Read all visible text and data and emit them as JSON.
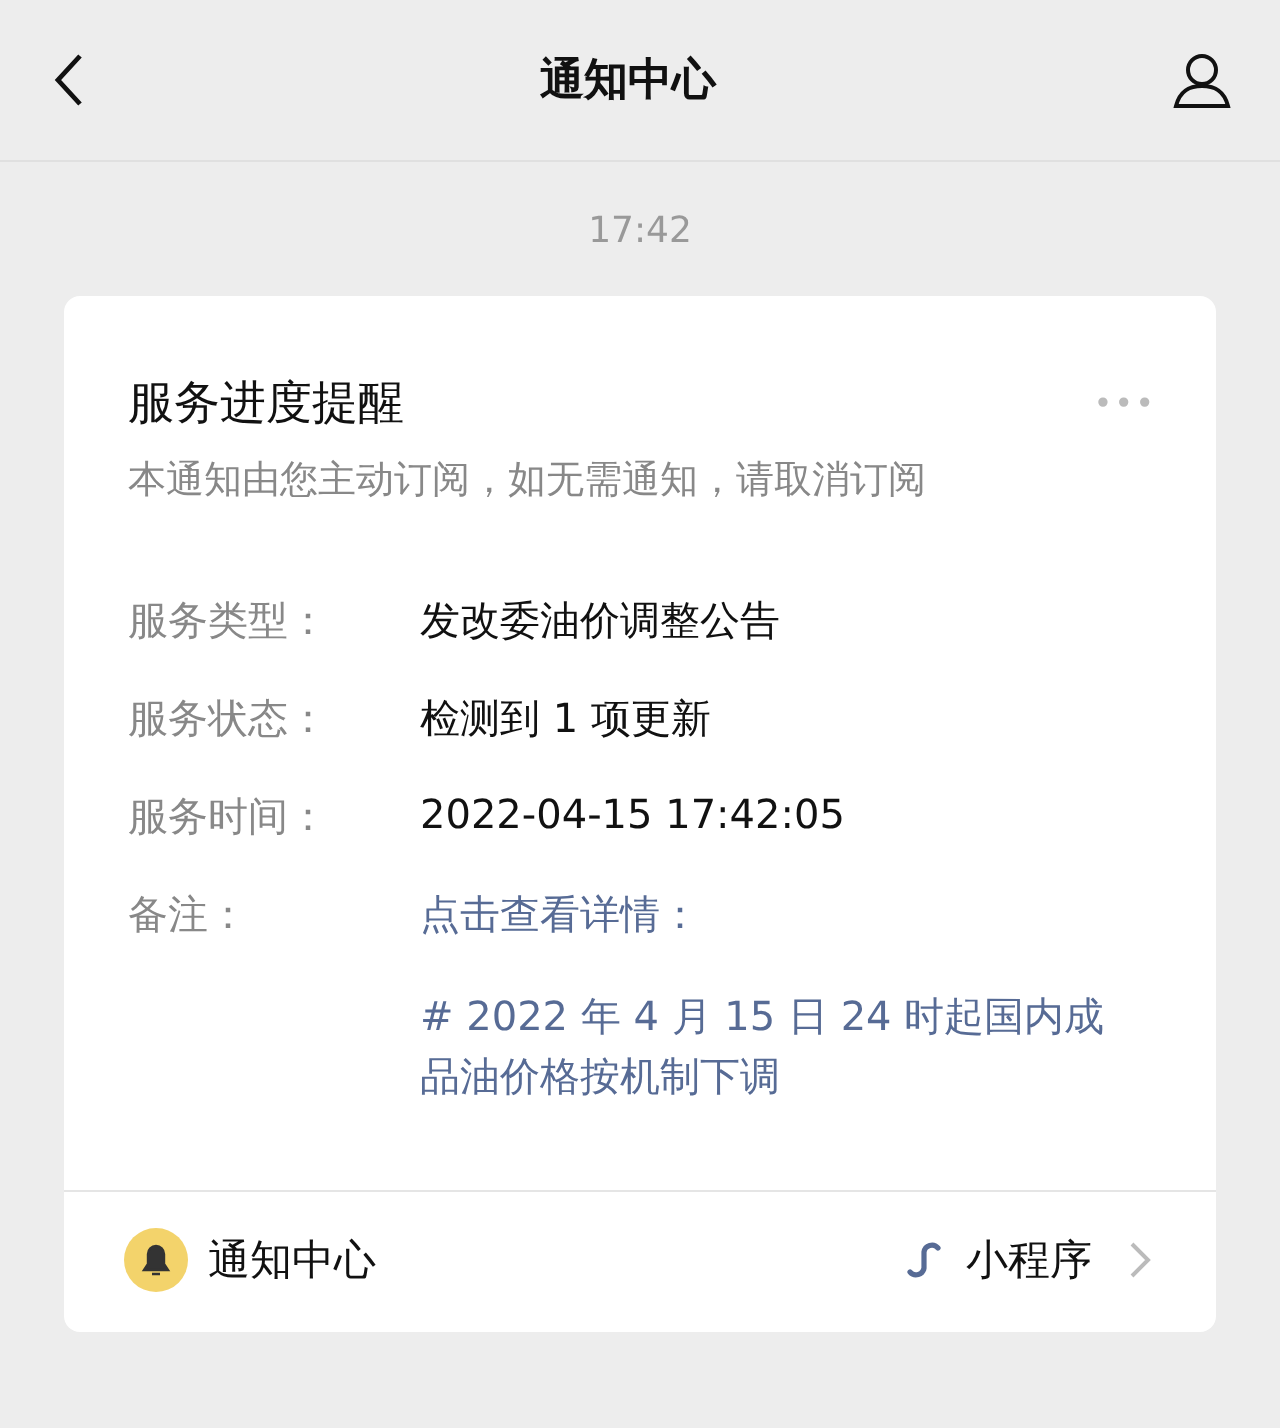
{
  "header": {
    "title": "通知中心"
  },
  "time": "17:42",
  "card": {
    "title": "服务进度提醒",
    "more": "•••",
    "subtitle": "本通知由您主动订阅，如无需通知，请取消订阅",
    "fields": [
      {
        "label": "服务类型：",
        "kind": "text",
        "value": "发改委油价调整公告"
      },
      {
        "label": "服务状态：",
        "kind": "text",
        "value": "检测到 1 项更新"
      },
      {
        "label": "服务时间：",
        "kind": "text",
        "value": "2022-04-15 17:42:05"
      },
      {
        "label": "备注：",
        "kind": "link",
        "value": "点击查看详情："
      }
    ],
    "detail": "# 2022 年 4 月 15 日 24 时起国内成品油价格按机制下调",
    "footer": {
      "source": "通知中心",
      "app": "小程序"
    }
  }
}
